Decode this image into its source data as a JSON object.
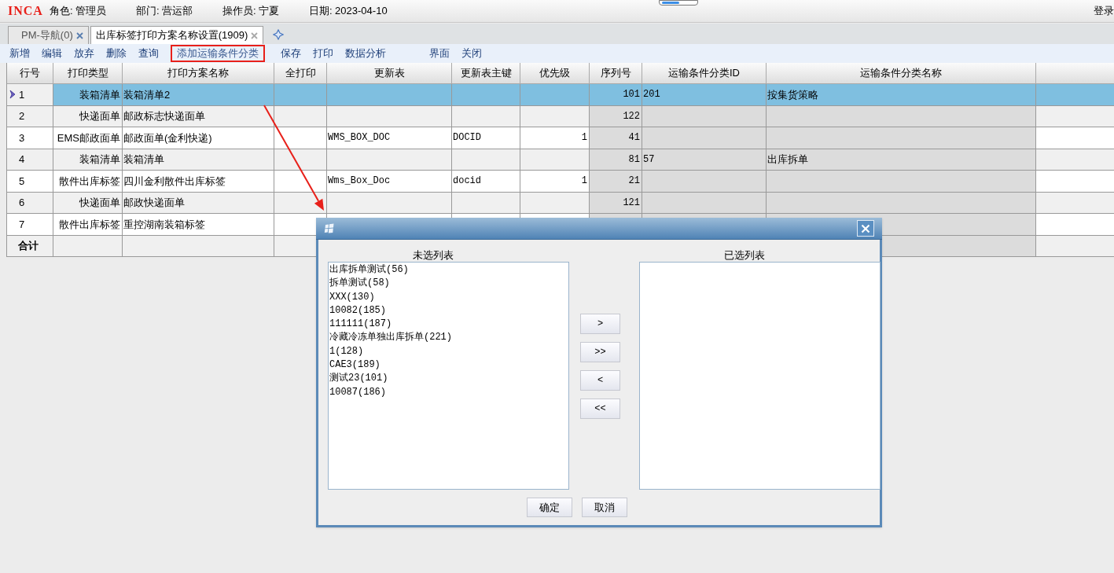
{
  "header": {
    "logo": "INCA",
    "fields": [
      "角色: 管理员",
      "部门: 营运部",
      "操作员: 宁夏",
      "日期: 2023-04-10"
    ],
    "login": "登录"
  },
  "tabs": [
    {
      "label": "PM-导航(0)",
      "selected": false
    },
    {
      "label": "出库标签打印方案名称设置(1909)",
      "selected": true
    }
  ],
  "toolbar": [
    {
      "label": "新增",
      "highlighted": false
    },
    {
      "label": "编辑",
      "highlighted": false
    },
    {
      "label": "放弃",
      "highlighted": false
    },
    {
      "label": "删除",
      "highlighted": false
    },
    {
      "label": "查询",
      "highlighted": false
    },
    {
      "label": "添加运输条件分类",
      "highlighted": true
    },
    {
      "label": "保存",
      "highlighted": false
    },
    {
      "label": "打印",
      "highlighted": false
    },
    {
      "label": "数据分析",
      "highlighted": false
    },
    {
      "label": "界面",
      "highlighted": false
    },
    {
      "label": "关闭",
      "highlighted": false
    }
  ],
  "table": {
    "columns": [
      "行号",
      "打印类型",
      "打印方案名称",
      "全打印",
      "更新表",
      "更新表主键",
      "优先级",
      "序列号",
      "运输条件分类ID",
      "运输条件分类名称"
    ],
    "rows": [
      {
        "selected": true,
        "row_no": "1",
        "print_type": "装箱清单",
        "scheme_name": "装箱清单2",
        "sequence": "101",
        "category_id": "201",
        "category_name": "按集货策略"
      },
      {
        "selected": false,
        "row_no": "2",
        "print_type": "快递面单",
        "scheme_name": "邮政标志快递面单",
        "sequence": "122"
      },
      {
        "selected": false,
        "row_no": "3",
        "print_type": "EMS邮政面单",
        "scheme_name": "邮政面单(金利快递)",
        "update_table": "WMS_BOX_DOC",
        "update_key": "DOCID",
        "priority": "1",
        "sequence": "41"
      },
      {
        "selected": false,
        "row_no": "4",
        "print_type": "装箱清单",
        "scheme_name": "装箱清单",
        "sequence": "81",
        "category_id": "57",
        "category_name": "出库拆单"
      },
      {
        "selected": false,
        "row_no": "5",
        "print_type": "散件出库标签",
        "scheme_name": "四川金利散件出库标签",
        "update_table": "Wms_Box_Doc",
        "update_key": "docid",
        "priority": "1",
        "sequence": "21"
      },
      {
        "selected": false,
        "row_no": "6",
        "print_type": "快递面单",
        "scheme_name": "邮政快递面单",
        "sequence": "121"
      },
      {
        "selected": false,
        "row_no": "7",
        "print_type": "散件出库标签",
        "scheme_name": "重控湖南装箱标签"
      }
    ],
    "footer": "合计"
  },
  "dialog": {
    "left_title": "未选列表",
    "right_title": "已选列表",
    "available": [
      "出库拆单测试(56)",
      "拆单测试(58)",
      "XXX(130)",
      "10082(185)",
      "111111(187)",
      "冷藏冷冻单独出库拆单(221)",
      "1(128)",
      "CAE3(189)",
      "测试23(101)",
      "10087(186)"
    ],
    "transfer_buttons": [
      ">",
      ">>",
      "<",
      "<<"
    ],
    "buttons": [
      "确定",
      "取消"
    ]
  }
}
